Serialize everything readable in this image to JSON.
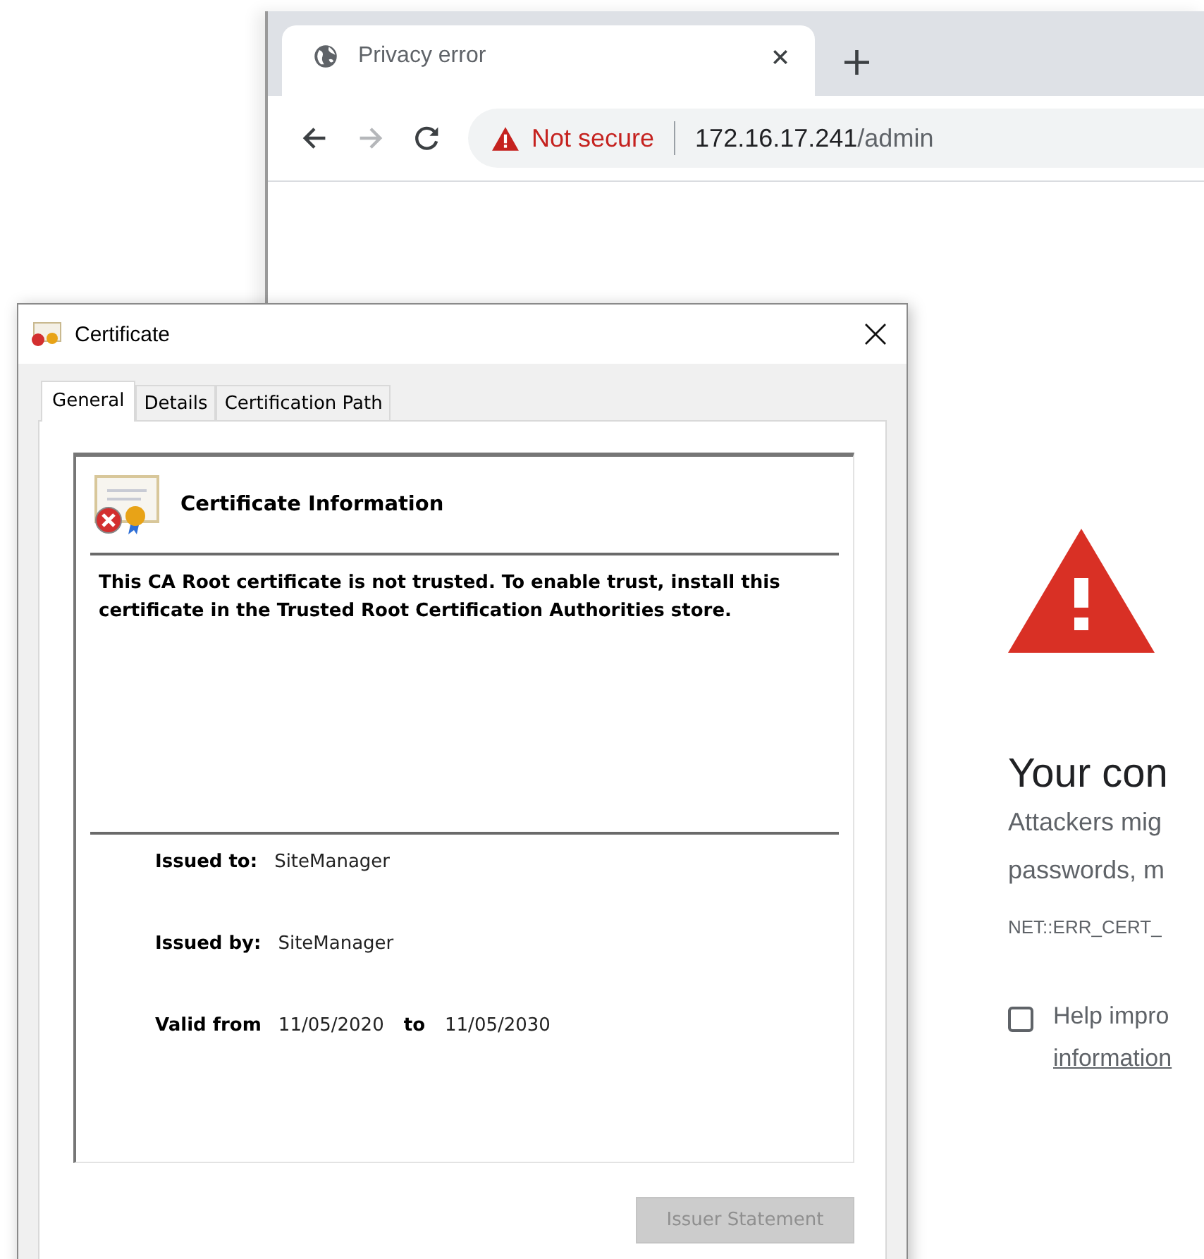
{
  "browser": {
    "tabs": [
      {
        "title": "Privacy error",
        "selected": true
      }
    ],
    "new_tab": "+",
    "address": {
      "security": "Not secure",
      "host": "172.16.17.241",
      "path": "/admin"
    },
    "page": {
      "heading": "Your con",
      "paragraph": [
        "Attackers mig",
        "passwords, m"
      ],
      "error_code": "NET::ERR_CERT_",
      "report": {
        "checked": false,
        "text": "Help impro",
        "link": "information"
      }
    }
  },
  "dialog": {
    "title": "Certificate",
    "tabs": [
      {
        "label": "General",
        "selected": true
      },
      {
        "label": "Details",
        "selected": false
      },
      {
        "label": "Certification Path",
        "selected": false
      }
    ],
    "info_heading": "Certificate Information",
    "message": "This CA Root certificate is not trusted. To enable trust, install this certificate in the Trusted Root Certification Authorities store.",
    "fields": [
      {
        "label": "Issued to:",
        "value": "SiteManager"
      },
      {
        "label": "Issued by:",
        "value": "SiteManager"
      }
    ],
    "valid": {
      "label": "Valid from",
      "from": "11/05/2020",
      "to_label": "to",
      "to": "11/05/2030"
    },
    "button": {
      "label": "Issuer Statement",
      "disabled": true
    }
  }
}
